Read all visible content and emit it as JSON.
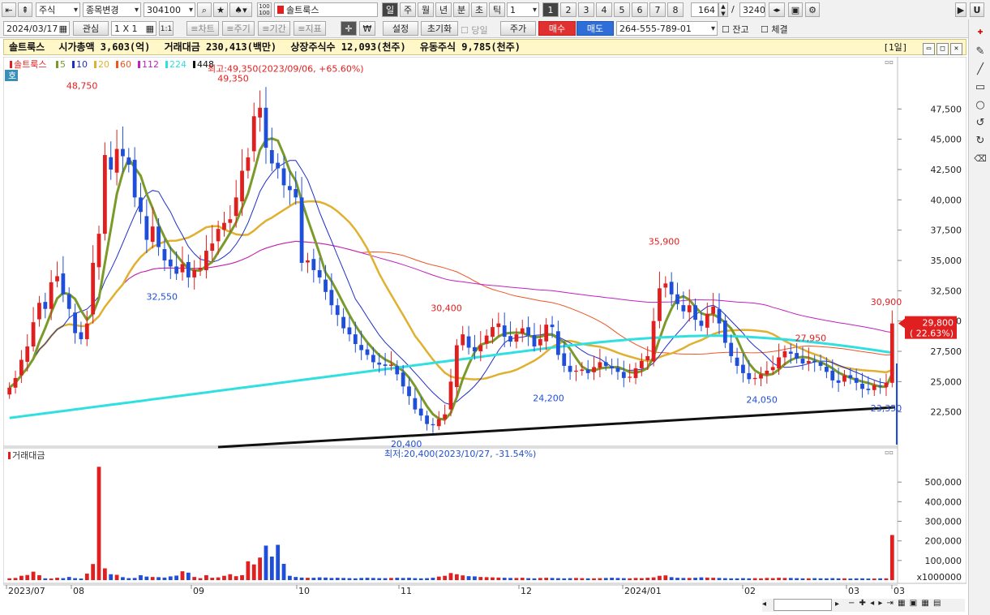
{
  "toolbar1": {
    "market": "주식",
    "change_label": "종목변경",
    "code": "304100",
    "stock_name": "솔트룩스",
    "periods": [
      "일",
      "주",
      "월",
      "년",
      "분",
      "초",
      "틱"
    ],
    "period_count": "1",
    "numbers": [
      "1",
      "2",
      "3",
      "4",
      "5",
      "6",
      "7",
      "8"
    ],
    "count_value": "164",
    "count_sep": "/",
    "count_total": "3240"
  },
  "toolbar2": {
    "date": "2024/03/17",
    "watch_label": "관심",
    "layout_label": "1 X 1",
    "chart_label": "≡차트",
    "period_label": "≡주기",
    "range_label": "≡기간",
    "indicator_label": "≡지표",
    "won_label": "₩",
    "settings_label": "설정",
    "reset_label": "초기화",
    "today_label": "당일",
    "price_label": "주가",
    "buy_label": "매수",
    "sell_label": "매도",
    "account": "264-555-789-01",
    "balance_label": "잔고",
    "fill_label": "체결"
  },
  "infobar": {
    "name": "솔트룩스",
    "market_cap": "시가총액 3,603(억)",
    "trade_value": "거래대금 230,413(백만)",
    "listed_shares": "상장주식수 12,093(천주)",
    "float_shares": "유동주식 9,785(천주)",
    "view_label": "[1일]"
  },
  "icons": {
    "right_tools": [
      "pencil-icon",
      "line-icon",
      "rectangle-icon",
      "circle-icon",
      "undo-icon",
      "redo-icon",
      "eraser-icon"
    ]
  },
  "colors": {
    "up": "#e02020",
    "down": "#1f4fd8",
    "ma5": "#3a3aa8",
    "ma10": "#1e2fc8",
    "ma20": "#7a9a2a",
    "ma60": "#e0b030",
    "ma112": "#ee5522",
    "ma224": "#c020c0",
    "ma448": "#30e0e0",
    "trend": "#111111"
  },
  "chart_data": {
    "type": "candlestick",
    "legend": [
      {
        "name": "솔트룩스",
        "color": "#e02020"
      },
      {
        "name": "5",
        "color": "#7a9a2a"
      },
      {
        "name": "10",
        "color": "#1e2fc8"
      },
      {
        "name": "20",
        "color": "#e0b030"
      },
      {
        "name": "60",
        "color": "#ee5522"
      },
      {
        "name": "112",
        "color": "#c020c0"
      },
      {
        "name": "224",
        "color": "#30e0e0"
      },
      {
        "name": "448",
        "color": "#111111"
      }
    ],
    "price_ticks": [
      "47,500",
      "45,000",
      "42,500",
      "40,000",
      "37,500",
      "35,000",
      "32,500",
      "30,000",
      "27,500",
      "25,000",
      "22,500"
    ],
    "price_range": [
      19800,
      50600
    ],
    "volume_label": "거래대금",
    "volume_ticks": [
      "500,000",
      "400,000",
      "300,000",
      "200,000",
      "100,000"
    ],
    "volume_unit": "x1000000",
    "volume_range": [
      0,
      600000
    ],
    "x_labels": [
      "2023/07",
      "08",
      "09",
      "10",
      "11",
      "12",
      "2024/01",
      "02",
      "03",
      "03"
    ],
    "annotations": {
      "high_text": "최고:49,350(2023/09/06, +65.60%)",
      "low_text": "최저:20,400(2023/10/27, -31.54%)",
      "labels": [
        {
          "text": "48,750",
          "value": 48750
        },
        {
          "text": "49,350",
          "value": 49350
        },
        {
          "text": "32,550",
          "value": 32550
        },
        {
          "text": "30,400",
          "value": 30400
        },
        {
          "text": "20,400",
          "value": 20400
        },
        {
          "text": "24,200",
          "value": 24200
        },
        {
          "text": "35,900",
          "value": 35900
        },
        {
          "text": "27,950",
          "value": 27950
        },
        {
          "text": "24,050",
          "value": 24050
        },
        {
          "text": "30,900",
          "value": 30900
        },
        {
          "text": "23,350",
          "value": 23350
        }
      ],
      "current_price": "29,800",
      "current_change": "( 22.63%)",
      "current_value": 29800
    },
    "tab_label": "호",
    "closes": [
      24500,
      25300,
      26800,
      27900,
      29900,
      31500,
      31000,
      33200,
      33700,
      32200,
      31000,
      29000,
      28500,
      29800,
      34800,
      37200,
      43700,
      42500,
      44200,
      43600,
      42900,
      40200,
      39000,
      36700,
      37800,
      36100,
      35000,
      34500,
      33900,
      34700,
      33600,
      34200,
      34400,
      35800,
      36400,
      37600,
      38100,
      38400,
      40200,
      42400,
      43500,
      46900,
      47600,
      44300,
      43000,
      42600,
      41200,
      40800,
      40200,
      34800,
      35000,
      34200,
      33600,
      32400,
      31300,
      30500,
      29400,
      28900,
      28100,
      27600,
      27200,
      26600,
      26400,
      26300,
      26400,
      25600,
      24600,
      23800,
      22700,
      22200,
      21500,
      21400,
      21900,
      22300,
      25000,
      28000,
      28900,
      27800,
      27500,
      28000,
      28800,
      29500,
      29800,
      28700,
      28300,
      28900,
      29400,
      28800,
      27900,
      28500,
      29700,
      29500,
      27200,
      26300,
      25800,
      25900,
      26000,
      25700,
      26200,
      26600,
      26300,
      26100,
      25800,
      25300,
      25400,
      26100,
      26700,
      27100,
      30000,
      32700,
      33100,
      32200,
      31400,
      30800,
      31300,
      30100,
      29600,
      30600,
      31200,
      29800,
      28200,
      27100,
      26300,
      25700,
      25200,
      25300,
      25600,
      25900,
      26200,
      27000,
      27500,
      27300,
      26900,
      26500,
      26700,
      26600,
      26300,
      25800,
      25100,
      24900,
      25500,
      25300,
      24900,
      24400,
      24300,
      24700,
      24600,
      24900,
      29800
    ],
    "volumes": [
      9000,
      11000,
      22000,
      26000,
      43000,
      25000,
      9000,
      8000,
      12000,
      10000,
      16000,
      10000,
      8000,
      33000,
      82000,
      578000,
      60000,
      30000,
      27000,
      15000,
      10000,
      11000,
      25000,
      18000,
      16000,
      15000,
      13000,
      19000,
      23000,
      45000,
      38000,
      16000,
      10000,
      25000,
      12000,
      14000,
      22000,
      30000,
      20000,
      25000,
      96000,
      80000,
      115000,
      176000,
      120000,
      180000,
      83000,
      22000,
      16000,
      13000,
      12000,
      12000,
      14000,
      13000,
      11000,
      12000,
      11000,
      10000,
      9000,
      11000,
      12000,
      11000,
      10000,
      10000,
      11000,
      12000,
      11000,
      12000,
      10000,
      9000,
      10000,
      12000,
      18000,
      22000,
      36000,
      30000,
      24000,
      20000,
      19000,
      16000,
      15000,
      14000,
      13000,
      12000,
      11000,
      11000,
      12000,
      10000,
      9000,
      11000,
      12000,
      11000,
      10000,
      9000,
      10000,
      11000,
      10000,
      9000,
      9000,
      10000,
      11000,
      12000,
      11000,
      10000,
      9000,
      11000,
      10000,
      12000,
      14000,
      22000,
      24000,
      15000,
      12000,
      11000,
      11000,
      12000,
      14000,
      13000,
      12000,
      11000,
      10000,
      9000,
      9000,
      10000,
      9000,
      10000,
      9000,
      11000,
      10000,
      12000,
      11000,
      11000,
      10000,
      9000,
      9000,
      10000,
      9000,
      9000,
      10000,
      9000,
      9000,
      8000,
      9000,
      9000,
      8000,
      8000,
      9000,
      9000,
      230000
    ]
  }
}
